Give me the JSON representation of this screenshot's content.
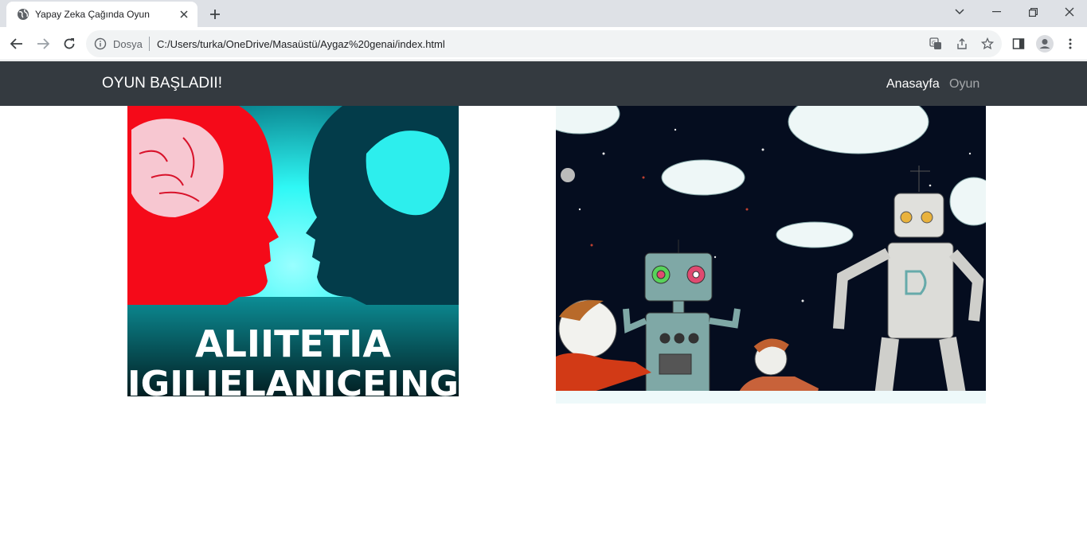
{
  "browser": {
    "tab_title": "Yapay Zeka Çağında Oyun",
    "security_label": "Dosya",
    "url": "C:/Users/turka/OneDrive/Masaüstü/Aygaz%20genai/index.html"
  },
  "navbar": {
    "brand": "OYUN BAŞLADII!",
    "links": [
      {
        "label": "Anasayfa",
        "active": true
      },
      {
        "label": "Oyun",
        "active": false
      }
    ]
  },
  "images": [
    {
      "name": "ai-heads-poster",
      "text_lines": [
        "ALIITETIA",
        "IGILIELANICEING"
      ],
      "colors": {
        "left_head": "#f50a19",
        "right_head": "#033c4a",
        "background": "#2ff8f5"
      }
    },
    {
      "name": "robots-children-illustration",
      "colors": {
        "sky": "#050d1f",
        "robot": "#7fa8a6"
      }
    }
  ],
  "colors": {
    "navbar_bg": "#343a40",
    "tabstrip_bg": "#dee1e6"
  }
}
